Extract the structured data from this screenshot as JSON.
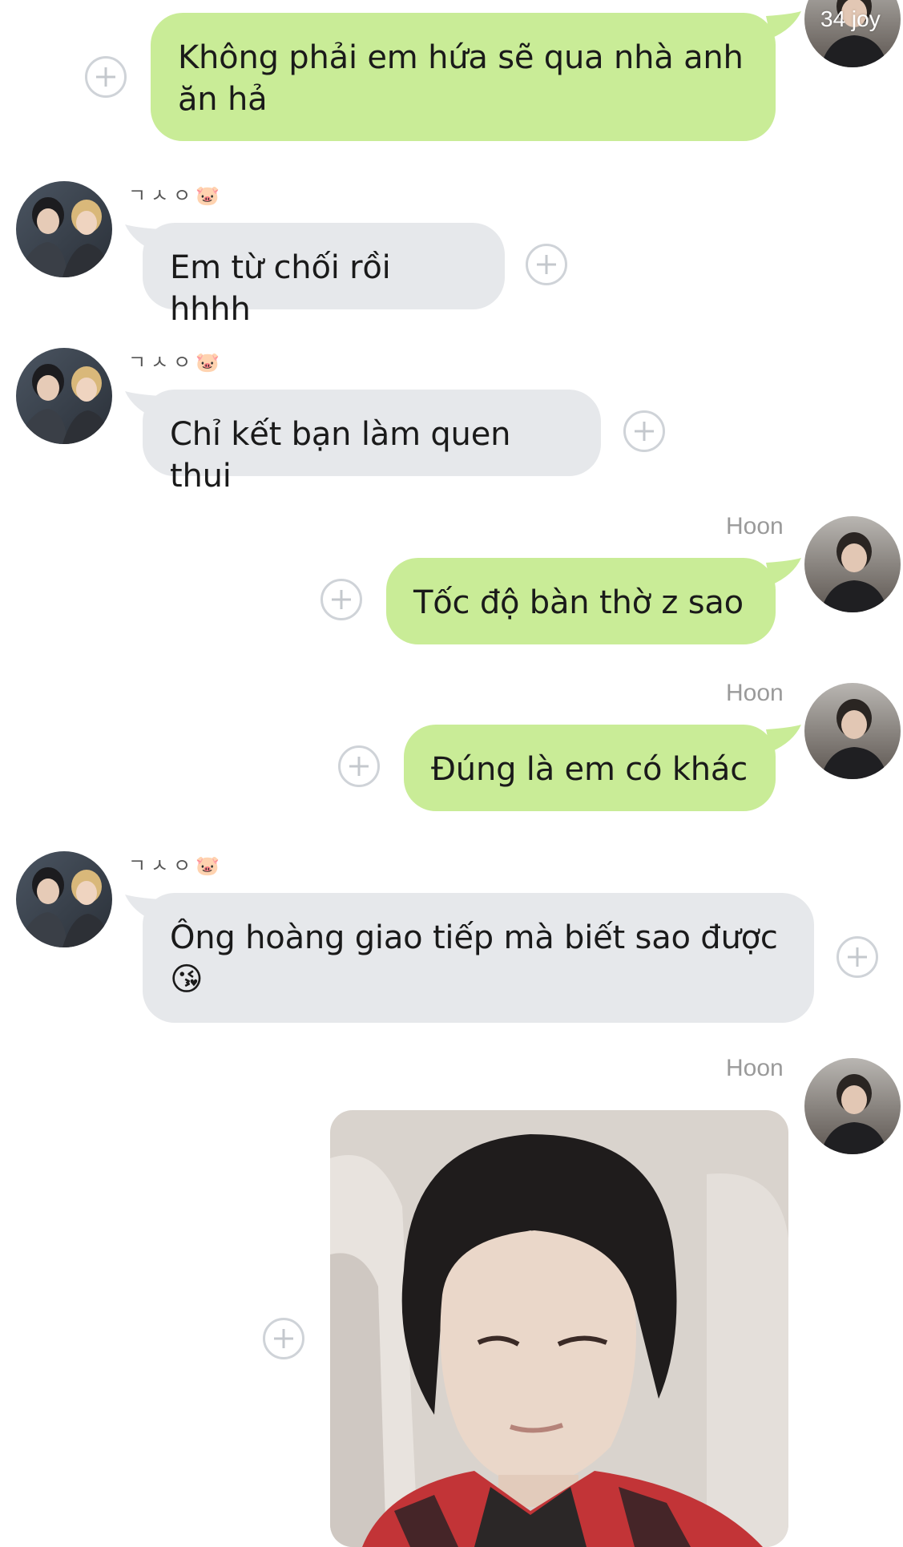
{
  "chat": {
    "top_overlay": "34 joy",
    "messages": [
      {
        "sender": "",
        "text": "Không phải em hứa sẽ qua nhà anh ăn hả"
      },
      {
        "sender": "ㄱㅅㅇ🐷",
        "text": "Em từ chối rồi hhhh"
      },
      {
        "sender": "ㄱㅅㅇ🐷",
        "text": "Chỉ kết bạn làm quen thui"
      },
      {
        "sender": "Hoon",
        "text": "Tốc độ bàn thờ z sao"
      },
      {
        "sender": "Hoon",
        "text": "Đúng là em có khác"
      },
      {
        "sender": "ㄱㅅㅇ🐷",
        "text": "Ông hoàng giao tiếp mà biết sao được 😘"
      },
      {
        "sender": "Hoon",
        "text": ""
      }
    ]
  },
  "colors": {
    "outgoing_bubble": "#c9ec97",
    "incoming_bubble": "#e6e8eb",
    "background": "#ffffff"
  },
  "icons": [
    "plus-circle-icon",
    "avatar-hoon",
    "avatar-group-photo"
  ]
}
